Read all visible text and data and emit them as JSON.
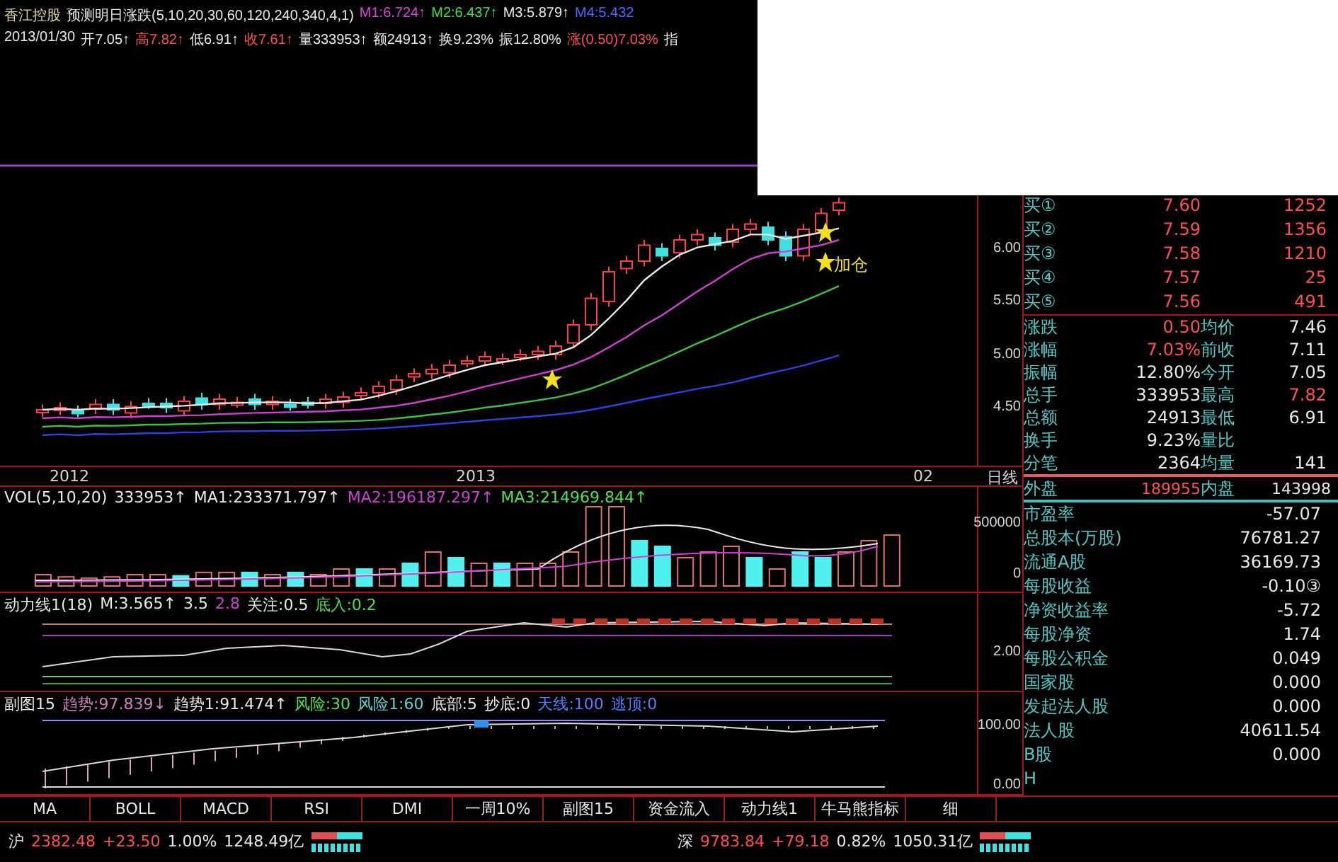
{
  "header": {
    "legend": [
      {
        "text": "香江控股",
        "color": "#e0d8a0"
      },
      {
        "text": "预测明日涨跌(5,10,20,30,60,120,240,340,4,1)",
        "color": "#e8e8e8"
      },
      {
        "text": "M1:6.724↑",
        "color": "#e040e0"
      },
      {
        "text": "M2:6.437↑",
        "color": "#40e040"
      },
      {
        "text": "M3:5.879↑",
        "color": "#e8e8e8"
      },
      {
        "text": "M4:5.432",
        "color": "#4a68ff"
      }
    ],
    "quote": [
      {
        "text": "2013/01/30",
        "color": "#e8e8e8"
      },
      {
        "text": "开7.05↑",
        "color": "#e8e8e8"
      },
      {
        "text": "高7.82↑",
        "color": "#ff5050"
      },
      {
        "text": "低6.91↑",
        "color": "#e8e8e8"
      },
      {
        "text": "收7.61↑",
        "color": "#ff5050"
      },
      {
        "text": "量333953↑",
        "color": "#e8e8e8"
      },
      {
        "text": "额24913↑",
        "color": "#e8e8e8"
      },
      {
        "text": "换9.23%",
        "color": "#e8e8e8"
      },
      {
        "text": "振12.80%",
        "color": "#e8e8e8"
      },
      {
        "text": "涨(0.50)7.03%",
        "color": "#ff5050"
      },
      {
        "text": "指",
        "color": "#e8e8e8"
      }
    ]
  },
  "main_chart": {
    "price_ticks": [
      "6.00",
      "5.50",
      "5.00",
      "4.50"
    ],
    "annotation": "加仓",
    "date_ticks": [
      "2012",
      "2013",
      "02"
    ],
    "period": "日线"
  },
  "volume_panel": {
    "legend": [
      {
        "text": "VOL(5,10,20)",
        "color": "#e8e8e8"
      },
      {
        "text": "333953↑",
        "color": "#e8e8e8"
      },
      {
        "text": "MA1:233371.797↑",
        "color": "#e8e8e8"
      },
      {
        "text": "MA2:196187.297↑",
        "color": "#d040d0"
      },
      {
        "text": "MA3:214969.844↑",
        "color": "#50e050"
      }
    ],
    "ticks": [
      "500000",
      "0"
    ]
  },
  "power_panel": {
    "legend": [
      {
        "text": "动力线1(18)",
        "color": "#e8e8e8"
      },
      {
        "text": "M:3.565↑",
        "color": "#e8e8e8"
      },
      {
        "text": "3.5",
        "color": "#e8e8e8"
      },
      {
        "text": "2.8",
        "color": "#d040d0"
      },
      {
        "text": "关注:0.5",
        "color": "#e8e8e8"
      },
      {
        "text": "底入:0.2",
        "color": "#50e050"
      }
    ],
    "ticks": [
      "2.00"
    ]
  },
  "sub15_panel": {
    "legend": [
      {
        "text": "副图15",
        "color": "#e8e8e8"
      },
      {
        "text": "趋势:97.839↓",
        "color": "#d080c0"
      },
      {
        "text": "趋势1:91.474↑",
        "color": "#e8e8e8"
      },
      {
        "text": "风险:30",
        "color": "#50e050"
      },
      {
        "text": "风险1:60",
        "color": "#60d0d0"
      },
      {
        "text": "底部:5",
        "color": "#e8e8e8"
      },
      {
        "text": "抄底:0",
        "color": "#e8e8e8"
      },
      {
        "text": "天线:100",
        "color": "#5080ff"
      },
      {
        "text": "逃顶:0",
        "color": "#5080ff"
      }
    ],
    "ticks": [
      "100.00",
      "0.00"
    ]
  },
  "order_book": [
    {
      "label": "买①",
      "price": "7.60",
      "volume": "1252"
    },
    {
      "label": "买②",
      "price": "7.59",
      "volume": "1356"
    },
    {
      "label": "买③",
      "price": "7.58",
      "volume": "1210"
    },
    {
      "label": "买④",
      "price": "7.57",
      "volume": "25"
    },
    {
      "label": "买⑤",
      "price": "7.56",
      "volume": "491"
    }
  ],
  "stats": [
    {
      "left": {
        "label": "涨跌",
        "value": "0.50",
        "color": "#ff5050"
      },
      "right": {
        "label": "均价",
        "value": "7.46",
        "color": "#e8e8e8"
      }
    },
    {
      "left": {
        "label": "涨幅",
        "value": "7.03%",
        "color": "#ff5050"
      },
      "right": {
        "label": "前收",
        "value": "7.11",
        "color": "#e8e8e8"
      }
    },
    {
      "left": {
        "label": "振幅",
        "value": "12.80%",
        "color": "#e8e8e8"
      },
      "right": {
        "label": "今开",
        "value": "7.05",
        "color": "#e8e8e8"
      }
    },
    {
      "left": {
        "label": "总手",
        "value": "333953",
        "color": "#e8e8e8"
      },
      "right": {
        "label": "最高",
        "value": "7.82",
        "color": "#ff5050"
      }
    },
    {
      "left": {
        "label": "总额",
        "value": "24913",
        "color": "#e8e8e8"
      },
      "right": {
        "label": "最低",
        "value": "6.91",
        "color": "#e8e8e8"
      }
    },
    {
      "left": {
        "label": "换手",
        "value": "9.23%",
        "color": "#e8e8e8"
      },
      "right": {
        "label": "量比"
      }
    },
    {
      "left": {
        "label": "分笔",
        "value": "2364",
        "color": "#e8e8e8"
      },
      "right": {
        "label": "均量",
        "value": "141",
        "color": "#e8e8e8"
      }
    }
  ],
  "trade_split": {
    "label": "外盘",
    "value": "189955",
    "label2": "内盘",
    "value2": "143998"
  },
  "fundamentals": [
    {
      "label": "市盈率",
      "value": "-57.07"
    },
    {
      "label": "总股本(万股)",
      "value": "76781.27"
    },
    {
      "label": "流通A股",
      "value": "36169.73"
    },
    {
      "label": "每股收益",
      "value": "-0.10③"
    },
    {
      "label": "净资收益率",
      "value": "-5.72"
    },
    {
      "label": "每股净资",
      "value": "1.74"
    },
    {
      "label": "每股公积金",
      "value": "0.049"
    },
    {
      "label": "国家股",
      "value": "0.000"
    },
    {
      "label": "发起法人股",
      "value": "0.000"
    },
    {
      "label": "法人股",
      "value": "40611.54"
    },
    {
      "label": "B股",
      "value": "0.000"
    },
    {
      "label": "H"
    }
  ],
  "tabs": [
    {
      "label": "MA",
      "selected": false
    },
    {
      "label": "BOLL",
      "selected": false
    },
    {
      "label": "MACD",
      "selected": false
    },
    {
      "label": "RSI",
      "selected": false
    },
    {
      "label": "DMI",
      "selected": false
    },
    {
      "label": "一周10%",
      "selected": false
    },
    {
      "label": "副图15",
      "selected": false
    },
    {
      "label": "资金流入",
      "selected": false
    },
    {
      "label": "动力线1",
      "selected": false
    },
    {
      "label": "牛马熊指标",
      "selected": false
    },
    {
      "label": "细",
      "selected": false
    }
  ],
  "status_bar": [
    {
      "name": "沪",
      "index": "2382.48",
      "change": "+23.50",
      "percent": "1.00%",
      "turnover": "1248.49亿"
    },
    {
      "name": "深",
      "index": "9783.84",
      "change": "+79.18",
      "percent": "0.82%",
      "turnover": "1050.31亿"
    }
  ]
}
